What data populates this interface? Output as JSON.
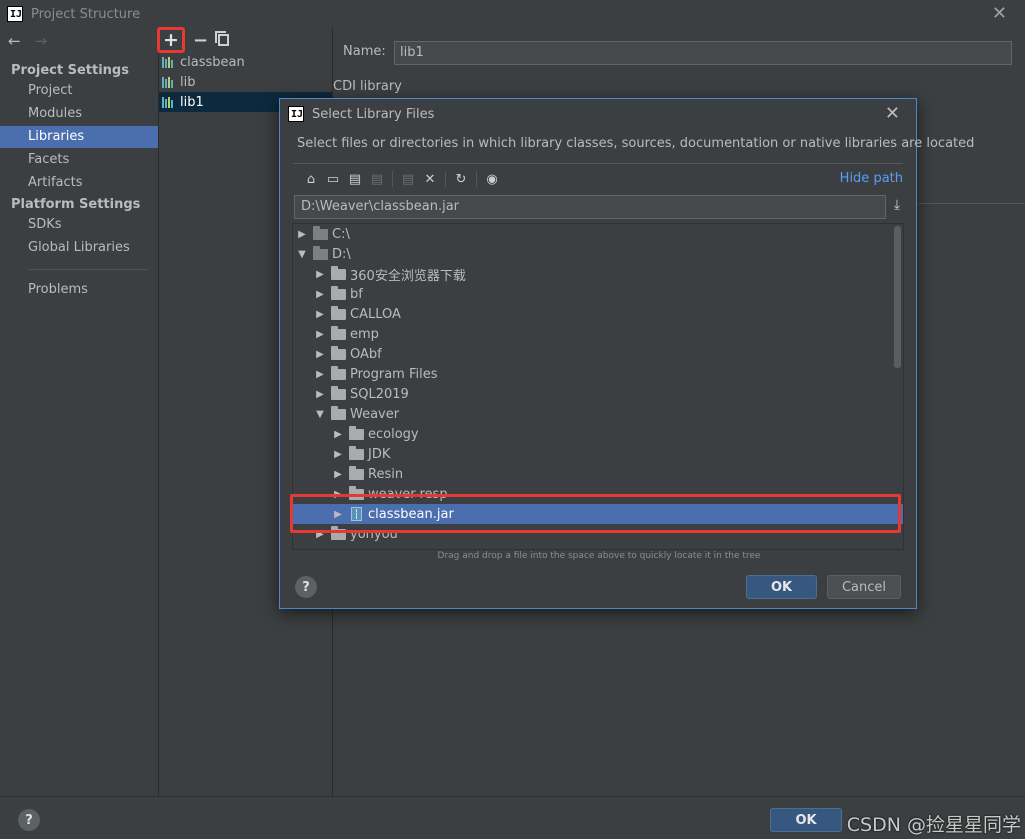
{
  "window": {
    "title": "Project Structure",
    "close_icon": "close-icon"
  },
  "nav": {
    "back": "←",
    "forward": "→"
  },
  "sidebar": {
    "sections": [
      {
        "heading": "Project Settings",
        "items": [
          "Project",
          "Modules",
          "Libraries",
          "Facets",
          "Artifacts"
        ]
      },
      {
        "heading": "Platform Settings",
        "items": [
          "SDKs",
          "Global Libraries"
        ]
      }
    ],
    "extra": "Problems",
    "selected": "Libraries"
  },
  "toolbar": {
    "add": "+",
    "remove": "−"
  },
  "libraries": [
    {
      "label": "classbean"
    },
    {
      "label": "lib"
    },
    {
      "label": "lib1",
      "selected": true
    }
  ],
  "details": {
    "name_label": "Name:",
    "name_value": "lib1",
    "type_label": "CDI library"
  },
  "dialog": {
    "title": "Select Library Files",
    "description": "Select files or directories in which library classes, sources, documentation or native libraries are located",
    "hide_path": "Hide path",
    "path": "D:\\Weaver\\classbean.jar",
    "hint": "Drag and drop a file into the space above to quickly locate it in the tree",
    "ok": "OK",
    "cancel": "Cancel",
    "help": "?",
    "tree": [
      {
        "label": "C:\\",
        "depth": 0,
        "expanded": false,
        "kind": "drive"
      },
      {
        "label": "D:\\",
        "depth": 0,
        "expanded": true,
        "kind": "drive"
      },
      {
        "label": "360安全浏览器下载",
        "depth": 1,
        "expanded": false,
        "kind": "folder"
      },
      {
        "label": "bf",
        "depth": 1,
        "expanded": false,
        "kind": "folder"
      },
      {
        "label": "CALLOA",
        "depth": 1,
        "expanded": false,
        "kind": "folder"
      },
      {
        "label": "emp",
        "depth": 1,
        "expanded": false,
        "kind": "folder"
      },
      {
        "label": "OAbf",
        "depth": 1,
        "expanded": false,
        "kind": "folder"
      },
      {
        "label": "Program Files",
        "depth": 1,
        "expanded": false,
        "kind": "folder"
      },
      {
        "label": "SQL2019",
        "depth": 1,
        "expanded": false,
        "kind": "folder"
      },
      {
        "label": "Weaver",
        "depth": 1,
        "expanded": true,
        "kind": "folder"
      },
      {
        "label": "ecology",
        "depth": 2,
        "expanded": false,
        "kind": "folder"
      },
      {
        "label": "JDK",
        "depth": 2,
        "expanded": false,
        "kind": "folder"
      },
      {
        "label": "Resin",
        "depth": 2,
        "expanded": false,
        "kind": "folder"
      },
      {
        "label": "weaver-resp",
        "depth": 2,
        "expanded": false,
        "kind": "folder"
      },
      {
        "label": "classbean.jar",
        "depth": 2,
        "expanded": false,
        "kind": "jar",
        "selected": true
      },
      {
        "label": "yonyou",
        "depth": 1,
        "expanded": false,
        "kind": "folder"
      }
    ]
  },
  "bottom": {
    "help": "?",
    "ok": "OK"
  },
  "watermark": "CSDN @捡星星同学"
}
